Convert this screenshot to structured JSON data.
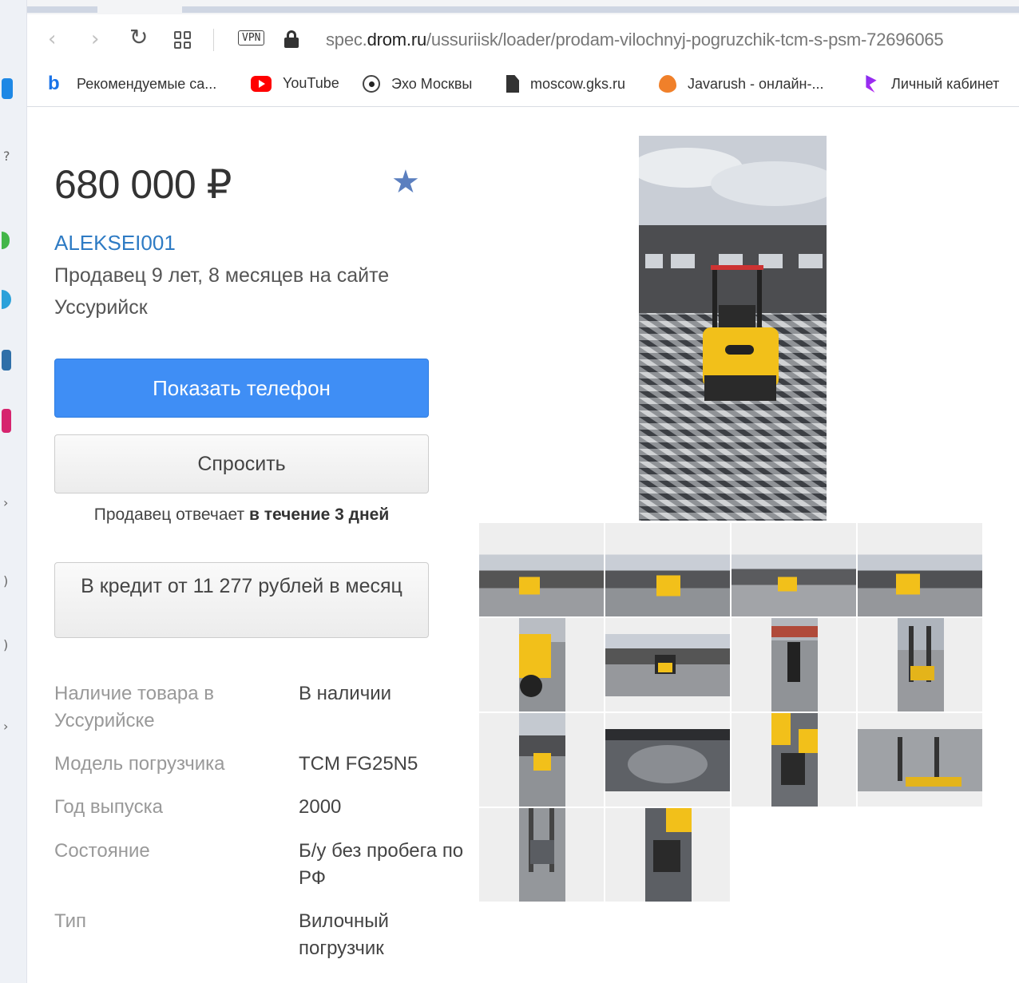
{
  "browser": {
    "url_prefix": "spec.",
    "url_host": "drom.ru",
    "url_path": "/ussuriisk/loader/prodam-vilochnyj-pogruzchik-tcm-s-psm-72696065",
    "vpn_label": "VPN"
  },
  "bookmarks": [
    {
      "label": "Рекомендуемые са...",
      "icon": "bing-icon"
    },
    {
      "label": "YouTube",
      "icon": "youtube-icon"
    },
    {
      "label": "Эхо Москвы",
      "icon": "echo-icon"
    },
    {
      "label": "moscow.gks.ru",
      "icon": "document-icon"
    },
    {
      "label": "Javarush - онлайн-...",
      "icon": "javarush-icon"
    },
    {
      "label": "Личный кабинет",
      "icon": "cabinet-icon"
    }
  ],
  "listing": {
    "price": "680 000 ₽",
    "seller_name": "ALEKSEI001",
    "seller_age": "Продавец 9 лет, 8 месяцев на сайте",
    "city": "Уссурийск",
    "show_phone_label": "Показать телефон",
    "ask_label": "Спросить",
    "reply_prefix": "Продавец отвечает ",
    "reply_time": "в течение 3 дней",
    "credit_label": "В кредит от 11 277 рублей в месяц"
  },
  "specs": [
    {
      "label": "Наличие товара в Уссурийске",
      "value": "В наличии"
    },
    {
      "label": "Модель погрузчика",
      "value": "TCM FG25N5"
    },
    {
      "label": "Год выпуска",
      "value": "2000"
    },
    {
      "label": "Состояние",
      "value": "Б/у без пробега по РФ"
    },
    {
      "label": "Тип",
      "value": "Вилочный погрузчик"
    }
  ],
  "colors": {
    "accent_blue": "#3f8ef5",
    "link_blue": "#2e7bc4",
    "forklift_yellow": "#f2c01a"
  }
}
